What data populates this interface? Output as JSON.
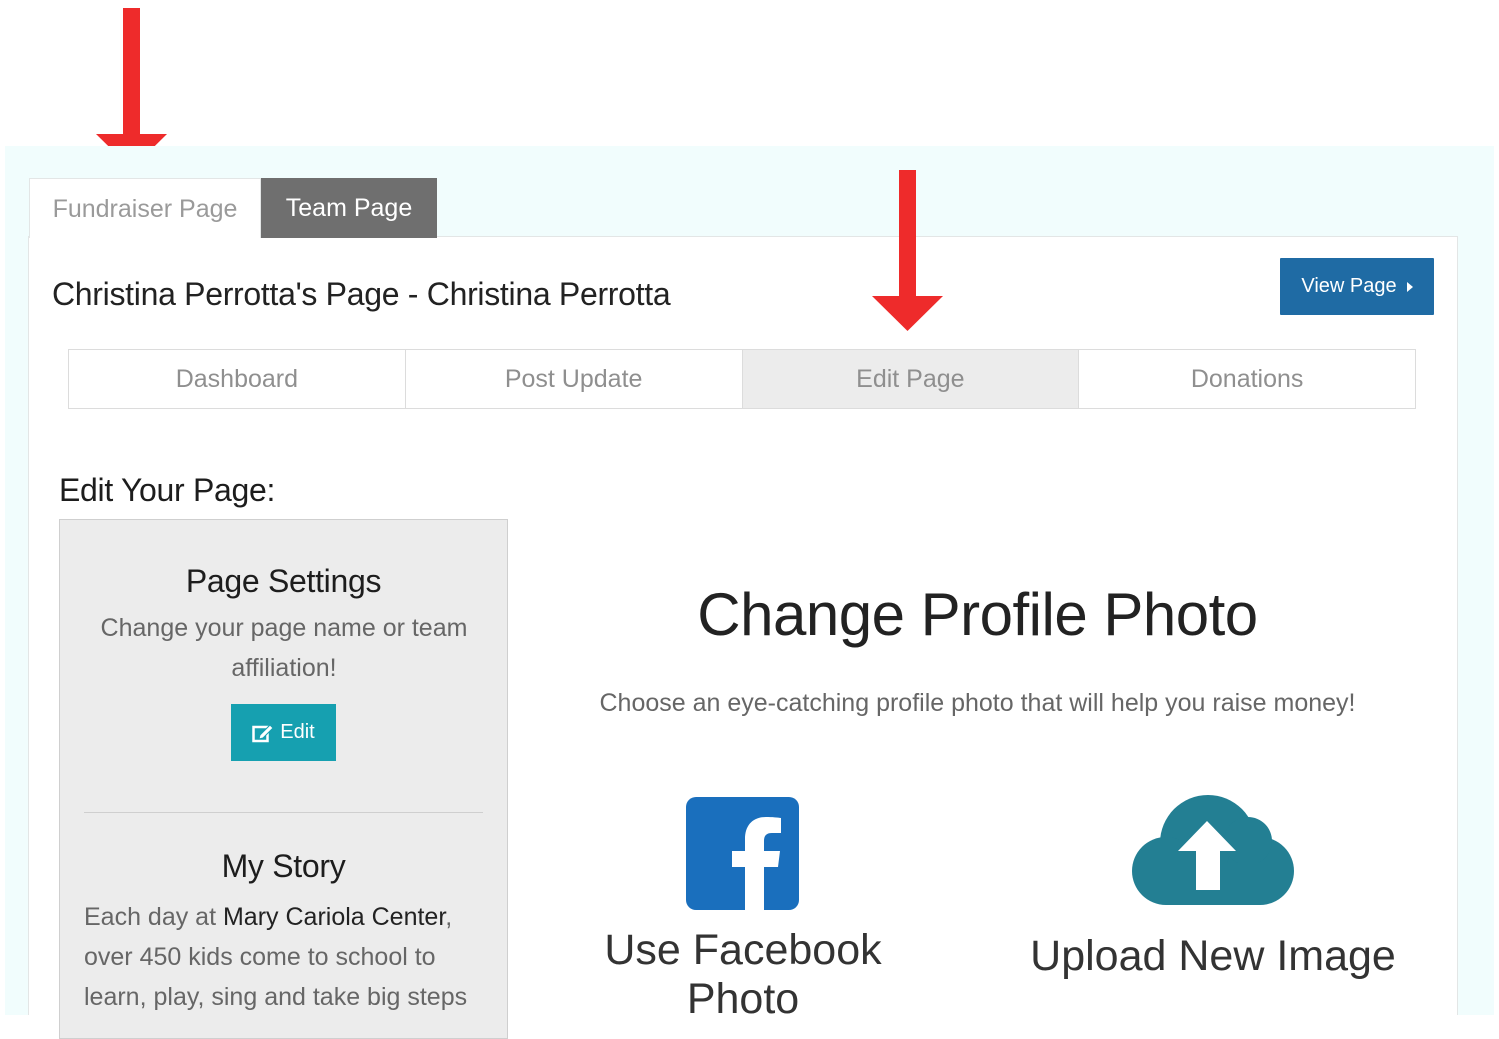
{
  "tabs": [
    {
      "label": "Fundraiser Page",
      "active": true
    },
    {
      "label": "Team Page",
      "active": false
    }
  ],
  "page_title": "Christina Perrotta's Page - Christina Perrotta",
  "view_button": {
    "label": "View Page"
  },
  "subnav": [
    {
      "label": "Dashboard"
    },
    {
      "label": "Post Update"
    },
    {
      "label": "Edit Page",
      "active": true
    },
    {
      "label": "Donations"
    }
  ],
  "edit_heading": "Edit Your Page:",
  "sidebar": {
    "settings": {
      "title": "Page Settings",
      "description": "Change your page name or team affiliation!",
      "button_label": "Edit"
    },
    "story": {
      "title": "My Story",
      "text_before": "Each day at ",
      "highlight": "Mary Cariola Center",
      "text_after": ", over 450 kids come to school to learn, play, sing and take big steps"
    }
  },
  "main": {
    "title": "Change Profile Photo",
    "subtitle": "Choose an eye-catching profile photo that will help you raise money!",
    "facebook_label": "Use Facebook Photo",
    "upload_label": "Upload New Image"
  },
  "colors": {
    "primary_button": "#1f6ba4",
    "edit_button": "#16a0b0",
    "facebook": "#1a6fbd",
    "cloud": "#237f93",
    "annotation_arrow": "#ee2b2b",
    "band": "#f1fdfd"
  },
  "icons": [
    "edit-icon",
    "caret-right-icon",
    "facebook-icon",
    "cloud-upload-icon",
    "annotation-arrow"
  ]
}
